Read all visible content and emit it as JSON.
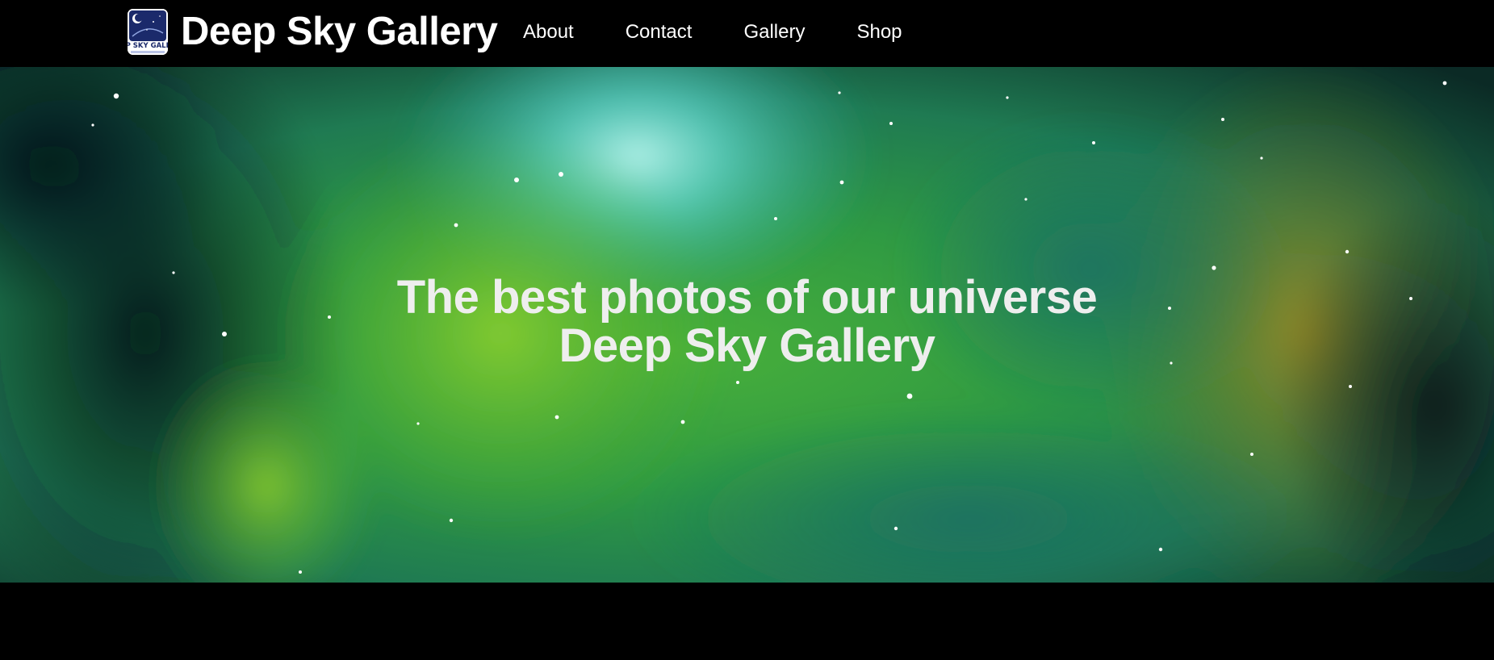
{
  "header": {
    "logo_text": "DEEP SKY GALLERY",
    "brand_title": "Deep Sky Gallery",
    "nav": [
      {
        "label": "About"
      },
      {
        "label": "Contact"
      },
      {
        "label": "Gallery"
      },
      {
        "label": "Shop"
      }
    ]
  },
  "hero": {
    "line1": "The best photos of our universe",
    "line2": "Deep Sky Gallery"
  },
  "colors": {
    "background": "#000000",
    "nav_text": "#ffffff",
    "hero_text": "#eeeeee",
    "logo_navy": "#1b2a6b"
  }
}
